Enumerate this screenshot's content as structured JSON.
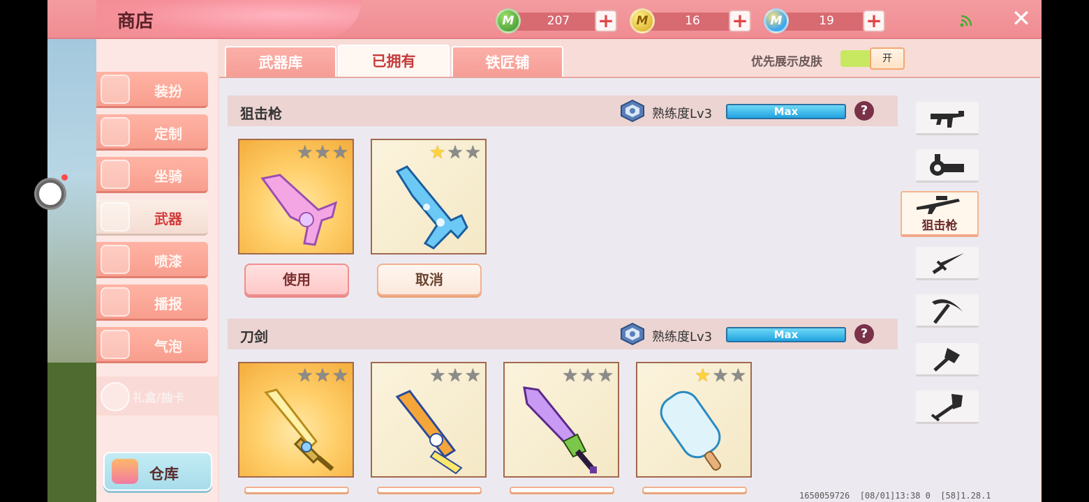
{
  "header": {
    "title": "商店",
    "currencies": [
      {
        "icon": "green-m-coin-icon",
        "amount": "207"
      },
      {
        "icon": "gold-m-coin-icon",
        "amount": "16"
      },
      {
        "icon": "blue-m-coin-icon",
        "amount": "19"
      }
    ]
  },
  "sidebar": {
    "items": [
      {
        "label": "装扮",
        "icon": "costume-icon"
      },
      {
        "label": "定制",
        "icon": "customize-icon"
      },
      {
        "label": "坐骑",
        "icon": "mount-icon"
      },
      {
        "label": "武器",
        "icon": "revolver-icon",
        "active": true
      },
      {
        "label": "喷漆",
        "icon": "spray-icon"
      },
      {
        "label": "播报",
        "icon": "broadcast-icon"
      },
      {
        "label": "气泡",
        "icon": "bubble-icon"
      }
    ],
    "gift": {
      "label": "礼盒/抽卡",
      "icon": "gift-icon"
    },
    "storage": {
      "label": "仓库",
      "icon": "chest-icon"
    }
  },
  "tabs": [
    {
      "label": "武器库"
    },
    {
      "label": "已拥有",
      "active": true
    },
    {
      "label": "铁匠铺"
    }
  ],
  "toggle": {
    "label": "优先展示皮肤",
    "state": "开"
  },
  "sections": [
    {
      "title": "狙击枪",
      "mastery": "熟练度Lv3",
      "bar": "Max",
      "items": [
        {
          "icon": "pink-rifle-icon",
          "stars": 0,
          "action": "使用"
        },
        {
          "icon": "ice-sniper-icon",
          "stars": 1,
          "action": "取消"
        }
      ]
    },
    {
      "title": "刀剑",
      "mastery": "熟练度Lv3",
      "bar": "Max",
      "items": [
        {
          "icon": "gold-sword-icon",
          "stars": 0
        },
        {
          "icon": "blue-chain-blade-icon",
          "stars": 0
        },
        {
          "icon": "purple-sword-icon",
          "stars": 0
        },
        {
          "icon": "popsicle-icon",
          "stars": 1
        }
      ]
    }
  ],
  "filters": [
    {
      "icon": "smg-icon"
    },
    {
      "icon": "gatling-icon"
    },
    {
      "icon": "sniper-icon",
      "label": "狙击枪",
      "active": true
    },
    {
      "icon": "dagger-icon"
    },
    {
      "icon": "pickaxe-icon"
    },
    {
      "icon": "axe-icon"
    },
    {
      "icon": "shovel-icon"
    }
  ],
  "build_info": "1650059726  [08/01]13:38 0  [58]1.28.1"
}
